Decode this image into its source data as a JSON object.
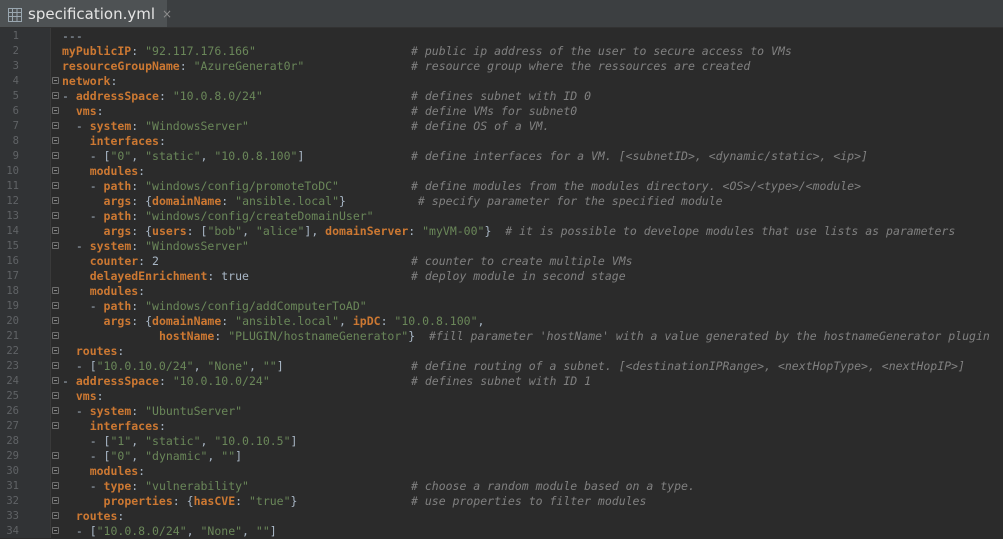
{
  "tab": {
    "label": "specification.yml",
    "close": "×",
    "icon": "yaml-file-icon"
  },
  "colors": {
    "background": "#2b2b2b",
    "key": "#cc7832",
    "string": "#6a8759",
    "comment": "#808080",
    "text": "#a9b7c6"
  },
  "lines": [
    {
      "n": "1",
      "fold": false,
      "code": [
        {
          "t": "---"
        }
      ],
      "comment": ""
    },
    {
      "n": "2",
      "fold": false,
      "code": [
        {
          "k": "myPublicIP"
        },
        {
          "t": ": "
        },
        {
          "s": "\"92.117.176.166\""
        }
      ],
      "comment": "# public ip address of the user to secure access to VMs"
    },
    {
      "n": "3",
      "fold": false,
      "code": [
        {
          "k": "resourceGroupName"
        },
        {
          "t": ": "
        },
        {
          "s": "\"AzureGenerat0r\""
        }
      ],
      "comment": "# resource group where the ressources are created"
    },
    {
      "n": "4",
      "fold": true,
      "code": [
        {
          "k": "network"
        },
        {
          "t": ":"
        }
      ],
      "comment": ""
    },
    {
      "n": "5",
      "fold": true,
      "code": [
        {
          "t": "- "
        },
        {
          "k": "addressSpace"
        },
        {
          "t": ": "
        },
        {
          "s": "\"10.0.8.0/24\""
        }
      ],
      "comment": "# defines subnet with ID 0"
    },
    {
      "n": "6",
      "fold": true,
      "code": [
        {
          "t": "  "
        },
        {
          "k": "vms"
        },
        {
          "t": ":"
        }
      ],
      "comment": "# define VMs for subnet0"
    },
    {
      "n": "7",
      "fold": true,
      "code": [
        {
          "t": "  - "
        },
        {
          "k": "system"
        },
        {
          "t": ": "
        },
        {
          "s": "\"WindowsServer\""
        }
      ],
      "comment": "# define OS of a VM."
    },
    {
      "n": "8",
      "fold": true,
      "code": [
        {
          "t": "    "
        },
        {
          "k": "interfaces"
        },
        {
          "t": ":"
        }
      ],
      "comment": ""
    },
    {
      "n": "9",
      "fold": true,
      "code": [
        {
          "t": "    - ["
        },
        {
          "s": "\"0\""
        },
        {
          "t": ", "
        },
        {
          "s": "\"static\""
        },
        {
          "t": ", "
        },
        {
          "s": "\"10.0.8.100\""
        },
        {
          "t": "]"
        }
      ],
      "comment": "# define interfaces for a VM. [<subnetID>, <dynamic/static>, <ip>]"
    },
    {
      "n": "10",
      "fold": true,
      "code": [
        {
          "t": "    "
        },
        {
          "k": "modules"
        },
        {
          "t": ":"
        }
      ],
      "comment": ""
    },
    {
      "n": "11",
      "fold": true,
      "code": [
        {
          "t": "    - "
        },
        {
          "k": "path"
        },
        {
          "t": ": "
        },
        {
          "s": "\"windows/config/promoteToDC\""
        }
      ],
      "comment": "# define modules from the modules directory. <OS>/<type>/<module>"
    },
    {
      "n": "12",
      "fold": true,
      "code": [
        {
          "t": "      "
        },
        {
          "k": "args"
        },
        {
          "t": ": {"
        },
        {
          "k": "domainName"
        },
        {
          "t": ": "
        },
        {
          "s": "\"ansible.local\""
        },
        {
          "t": "}"
        }
      ],
      "comment": " # specify parameter for the specified module"
    },
    {
      "n": "13",
      "fold": true,
      "code": [
        {
          "t": "    - "
        },
        {
          "k": "path"
        },
        {
          "t": ": "
        },
        {
          "s": "\"windows/config/createDomainUser\""
        }
      ],
      "comment": ""
    },
    {
      "n": "14",
      "fold": true,
      "code": [
        {
          "t": "      "
        },
        {
          "k": "args"
        },
        {
          "t": ": {"
        },
        {
          "k": "users"
        },
        {
          "t": ": ["
        },
        {
          "s": "\"bob\""
        },
        {
          "t": ", "
        },
        {
          "s": "\"alice\""
        },
        {
          "t": "], "
        },
        {
          "k": "domainServer"
        },
        {
          "t": ": "
        },
        {
          "s": "\"myVM-00\""
        },
        {
          "t": "}  "
        },
        {
          "c": "# it is possible to develope modules that use lists as parameters"
        }
      ],
      "comment": ""
    },
    {
      "n": "15",
      "fold": true,
      "code": [
        {
          "t": "  - "
        },
        {
          "k": "system"
        },
        {
          "t": ": "
        },
        {
          "s": "\"WindowsServer\""
        }
      ],
      "comment": ""
    },
    {
      "n": "16",
      "fold": false,
      "code": [
        {
          "t": "    "
        },
        {
          "k": "counter"
        },
        {
          "t": ": 2"
        }
      ],
      "comment": "# counter to create multiple VMs"
    },
    {
      "n": "17",
      "fold": false,
      "code": [
        {
          "t": "    "
        },
        {
          "k": "delayedEnrichment"
        },
        {
          "t": ": true"
        }
      ],
      "comment": "# deploy module in second stage"
    },
    {
      "n": "18",
      "fold": true,
      "code": [
        {
          "t": "    "
        },
        {
          "k": "modules"
        },
        {
          "t": ":"
        }
      ],
      "comment": ""
    },
    {
      "n": "19",
      "fold": true,
      "code": [
        {
          "t": "    - "
        },
        {
          "k": "path"
        },
        {
          "t": ": "
        },
        {
          "s": "\"windows/config/addComputerToAD\""
        }
      ],
      "comment": ""
    },
    {
      "n": "20",
      "fold": true,
      "code": [
        {
          "t": "      "
        },
        {
          "k": "args"
        },
        {
          "t": ": {"
        },
        {
          "k": "domainName"
        },
        {
          "t": ": "
        },
        {
          "s": "\"ansible.local\""
        },
        {
          "t": ", "
        },
        {
          "k": "ipDC"
        },
        {
          "t": ": "
        },
        {
          "s": "\"10.0.8.100\""
        },
        {
          "t": ","
        }
      ],
      "comment": ""
    },
    {
      "n": "21",
      "fold": true,
      "code": [
        {
          "t": "              "
        },
        {
          "k": "hostName"
        },
        {
          "t": ": "
        },
        {
          "s": "\"PLUGIN/hostnameGenerator\""
        },
        {
          "t": "}  "
        },
        {
          "c": "#fill parameter 'hostName' with a value generated by the hostnameGenerator plugin"
        }
      ],
      "comment": ""
    },
    {
      "n": "22",
      "fold": true,
      "code": [
        {
          "t": "  "
        },
        {
          "k": "routes"
        },
        {
          "t": ":"
        }
      ],
      "comment": ""
    },
    {
      "n": "23",
      "fold": true,
      "code": [
        {
          "t": "  - ["
        },
        {
          "s": "\"10.0.10.0/24\""
        },
        {
          "t": ", "
        },
        {
          "s": "\"None\""
        },
        {
          "t": ", "
        },
        {
          "s": "\"\""
        },
        {
          "t": "]"
        }
      ],
      "comment": "# define routing of a subnet. [<destinationIPRange>, <nextHopType>, <nextHopIP>]"
    },
    {
      "n": "24",
      "fold": true,
      "code": [
        {
          "t": "- "
        },
        {
          "k": "addressSpace"
        },
        {
          "t": ": "
        },
        {
          "s": "\"10.0.10.0/24\""
        }
      ],
      "comment": "# defines subnet with ID 1"
    },
    {
      "n": "25",
      "fold": true,
      "code": [
        {
          "t": "  "
        },
        {
          "k": "vms"
        },
        {
          "t": ":"
        }
      ],
      "comment": ""
    },
    {
      "n": "26",
      "fold": true,
      "code": [
        {
          "t": "  - "
        },
        {
          "k": "system"
        },
        {
          "t": ": "
        },
        {
          "s": "\"UbuntuServer\""
        }
      ],
      "comment": ""
    },
    {
      "n": "27",
      "fold": true,
      "code": [
        {
          "t": "    "
        },
        {
          "k": "interfaces"
        },
        {
          "t": ":"
        }
      ],
      "comment": ""
    },
    {
      "n": "28",
      "fold": false,
      "code": [
        {
          "t": "    - ["
        },
        {
          "s": "\"1\""
        },
        {
          "t": ", "
        },
        {
          "s": "\"static\""
        },
        {
          "t": ", "
        },
        {
          "s": "\"10.0.10.5\""
        },
        {
          "t": "]"
        }
      ],
      "comment": ""
    },
    {
      "n": "29",
      "fold": true,
      "code": [
        {
          "t": "    - ["
        },
        {
          "s": "\"0\""
        },
        {
          "t": ", "
        },
        {
          "s": "\"dynamic\""
        },
        {
          "t": ", "
        },
        {
          "s": "\"\""
        },
        {
          "t": "]"
        }
      ],
      "comment": ""
    },
    {
      "n": "30",
      "fold": true,
      "code": [
        {
          "t": "    "
        },
        {
          "k": "modules"
        },
        {
          "t": ":"
        }
      ],
      "comment": ""
    },
    {
      "n": "31",
      "fold": true,
      "code": [
        {
          "t": "    - "
        },
        {
          "k": "type"
        },
        {
          "t": ": "
        },
        {
          "s": "\"vulnerability\""
        }
      ],
      "comment": "# choose a random module based on a type."
    },
    {
      "n": "32",
      "fold": true,
      "code": [
        {
          "t": "      "
        },
        {
          "k": "properties"
        },
        {
          "t": ": {"
        },
        {
          "k": "hasCVE"
        },
        {
          "t": ": "
        },
        {
          "s": "\"true\""
        },
        {
          "t": "}"
        }
      ],
      "comment": "# use properties to filter modules"
    },
    {
      "n": "33",
      "fold": true,
      "code": [
        {
          "t": "  "
        },
        {
          "k": "routes"
        },
        {
          "t": ":"
        }
      ],
      "comment": ""
    },
    {
      "n": "34",
      "fold": true,
      "code": [
        {
          "t": "  - ["
        },
        {
          "s": "\"10.0.8.0/24\""
        },
        {
          "t": ", "
        },
        {
          "s": "\"None\""
        },
        {
          "t": ", "
        },
        {
          "s": "\"\""
        },
        {
          "t": "]"
        }
      ],
      "comment": ""
    }
  ]
}
